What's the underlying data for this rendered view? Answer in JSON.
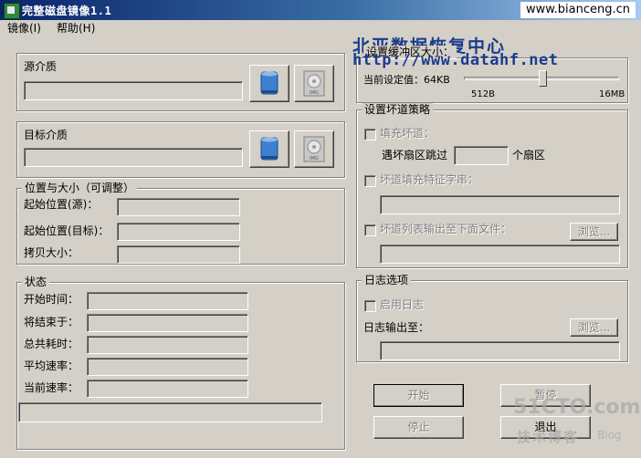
{
  "window": {
    "title": "完整磁盘镜像1.1"
  },
  "watermark_top": "www.bianceng.cn",
  "menu": [
    {
      "label": "镜像(I)"
    },
    {
      "label": "帮助(H)"
    }
  ],
  "overlay": {
    "company": "北亚数据恢复中心",
    "url": "http://www.datahf.net"
  },
  "source": {
    "label": "源介质",
    "value": ""
  },
  "target": {
    "label": "目标介质",
    "value": ""
  },
  "position": {
    "title": "位置与大小（可调整）",
    "start_source": {
      "label": "起始位置(源)：",
      "value": ""
    },
    "start_target": {
      "label": "起始位置(目标)：",
      "value": ""
    },
    "copy_size": {
      "label": "拷贝大小：",
      "value": ""
    }
  },
  "status": {
    "title": "状态",
    "start_time": {
      "label": "开始时间：",
      "value": ""
    },
    "end_time": {
      "label": "将结束于：",
      "value": ""
    },
    "total_time": {
      "label": "总共耗时：",
      "value": ""
    },
    "avg_rate": {
      "label": "平均速率：",
      "value": ""
    },
    "current_rate": {
      "label": "当前速率：",
      "value": ""
    },
    "progress": 0
  },
  "buffer": {
    "title": "设置缓冲区大小：",
    "current_label": "当前设定值：64KB",
    "min": "512B",
    "max": "16MB",
    "level": 0.56
  },
  "bad_track": {
    "title": "设置坏道策略",
    "fill_label": "填充坏道：",
    "skip_label": "遇坏扇区跳过",
    "skip_unit": "个扇区",
    "skip_value": "",
    "pattern_label": "坏道填充特征字串：",
    "pattern_value": "",
    "list_label": "坏道列表输出至下面文件：",
    "list_value": "",
    "browse_label": "浏览..."
  },
  "log": {
    "title": "日志选项",
    "enable_label": "启用日志",
    "output_label": "日志输出至：",
    "output_value": "",
    "browse_label": "浏览..."
  },
  "buttons": {
    "start": "开始",
    "pause": "暂停",
    "stop": "停止",
    "exit": "退出"
  },
  "watermark_bottom": {
    "site": "51CTO.com",
    "sub": "技术博客",
    "blog": "Blog"
  }
}
